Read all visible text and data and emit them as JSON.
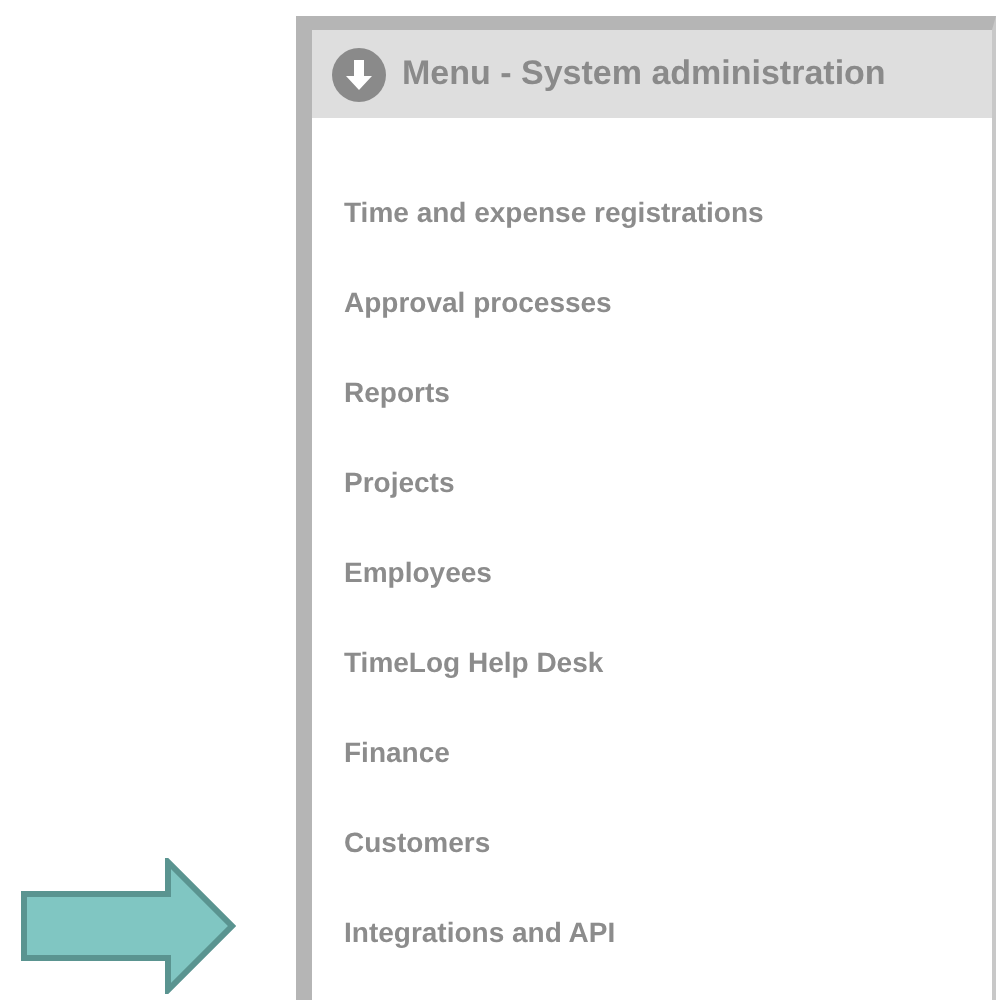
{
  "menu": {
    "title": "Menu - System administration",
    "items": [
      {
        "label": "Time and expense registrations"
      },
      {
        "label": "Approval processes"
      },
      {
        "label": "Reports"
      },
      {
        "label": "Projects"
      },
      {
        "label": "Employees"
      },
      {
        "label": "TimeLog Help Desk"
      },
      {
        "label": "Finance"
      },
      {
        "label": "Customers"
      },
      {
        "label": "Integrations and API"
      }
    ]
  }
}
